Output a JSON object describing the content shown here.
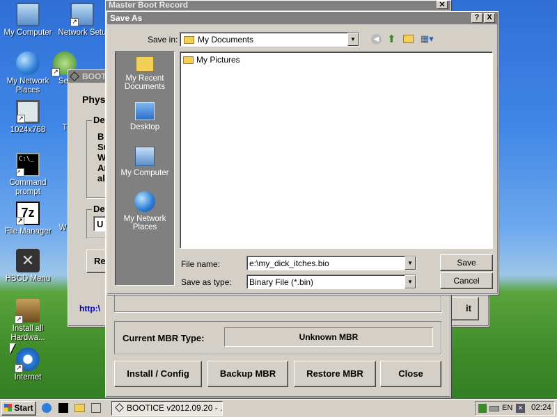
{
  "desktop": {
    "icons": [
      {
        "label": "My Computer"
      },
      {
        "label": "Network Setu"
      },
      {
        "label": "My Network Places"
      },
      {
        "label": "Se"
      },
      {
        "label": "1024x768"
      },
      {
        "label": "T"
      },
      {
        "label": "Command prompt"
      },
      {
        "label": "File Manager"
      },
      {
        "label": "W"
      },
      {
        "label": "HBCD Menu"
      },
      {
        "label": "Install all Hardwa..."
      },
      {
        "label": "Internet"
      }
    ]
  },
  "bootice": {
    "title": "BOOTICE",
    "phys": "Phys",
    "group1": "De",
    "lines": [
      "B",
      "Su",
      "W",
      "Ar",
      "al"
    ],
    "group2": "De",
    "sel": "U",
    "re": "Re",
    "link": "http:\\",
    "it": "it"
  },
  "mbr": {
    "title": "Master Boot Record",
    "current_label": "Current MBR Type:",
    "current_value": "Unknown MBR",
    "buttons": [
      "Install / Config",
      "Backup MBR",
      "Restore MBR",
      "Close"
    ]
  },
  "saveas": {
    "title": "Save As",
    "help": "?",
    "close": "X",
    "save_in_label": "Save in:",
    "save_in_value": "My Documents",
    "places": [
      "My Recent Documents",
      "Desktop",
      "My Computer",
      "My Network Places"
    ],
    "files": [
      "My Pictures"
    ],
    "filename_label": "File name:",
    "filename_value": "e:\\my_dick_itches.bio",
    "type_label": "Save as type:",
    "type_value": "Binary File (*.bin)",
    "save": "Save",
    "cancel": "Cancel"
  },
  "taskbar": {
    "start": "Start",
    "task": "BOOTICE v2012.09.20 - ...",
    "lang": "EN",
    "clock": "02:24"
  },
  "colors": {
    "titlebar_inactive": "#808080",
    "link": "#0000cc",
    "folder": "#f2cf57"
  }
}
